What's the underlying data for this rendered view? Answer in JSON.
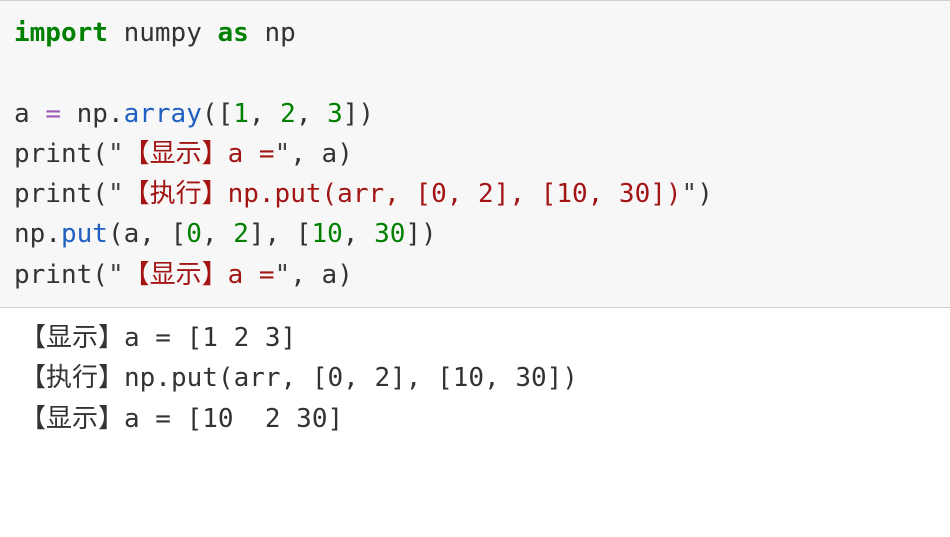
{
  "code": {
    "l1": {
      "kw_import": "import",
      "mod": "numpy",
      "kw_as": "as",
      "alias": "np"
    },
    "blank": "",
    "l2": {
      "lhs": "a",
      "eq": "=",
      "obj": "np",
      "dot": ".",
      "fn": "array",
      "open": "([",
      "n1": "1",
      "c1": ", ",
      "n2": "2",
      "c2": ", ",
      "n3": "3",
      "close": "])"
    },
    "l3": {
      "call": "print",
      "open": "(",
      "q1": "\"",
      "str": "【显示】a =",
      "q2": "\"",
      "comma": ", ",
      "arg": "a",
      "close": ")"
    },
    "l4": {
      "call": "print",
      "open": "(",
      "q1": "\"",
      "str": "【执行】np.put(arr, [0, 2], [10, 30])",
      "q2": "\"",
      "close": ")"
    },
    "l5": {
      "obj": "np",
      "dot": ".",
      "fn": "put",
      "open": "(",
      "arg1": "a",
      "c1": ", [",
      "n1": "0",
      "c2": ", ",
      "n2": "2",
      "c3": "], [",
      "n3": "10",
      "c4": ", ",
      "n4": "30",
      "c5": "])"
    },
    "l6": {
      "call": "print",
      "open": "(",
      "q1": "\"",
      "str": "【显示】a =",
      "q2": "\"",
      "comma": ", ",
      "arg": "a",
      "close": ")"
    }
  },
  "output": {
    "l1": "【显示】a = [1 2 3]",
    "l2": "【执行】np.put(arr, [0, 2], [10, 30])",
    "l3": "【显示】a = [10  2 30]"
  }
}
